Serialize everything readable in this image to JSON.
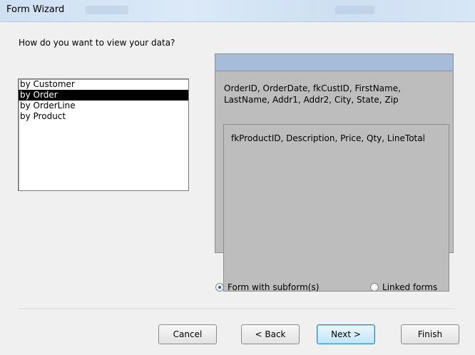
{
  "window": {
    "title": "Form Wizard"
  },
  "question": "How do you want to view your data?",
  "view_list": {
    "items": [
      "by Customer",
      "by Order",
      "by OrderLine",
      "by Product"
    ],
    "selected": "by Order"
  },
  "preview": {
    "main_fields": "OrderID, OrderDate, fkCustID, FirstName, LastName, Addr1, Addr2, City, State, Zip",
    "subform_fields": "fkProductID, Description, Price, Qty, LineTotal"
  },
  "options": {
    "form_with_subforms": "Form with subform(s)",
    "linked_forms": "Linked forms",
    "selected": "form_with_subforms"
  },
  "buttons": {
    "cancel": "Cancel",
    "back": "< Back",
    "next": "Next >",
    "finish": "Finish"
  }
}
